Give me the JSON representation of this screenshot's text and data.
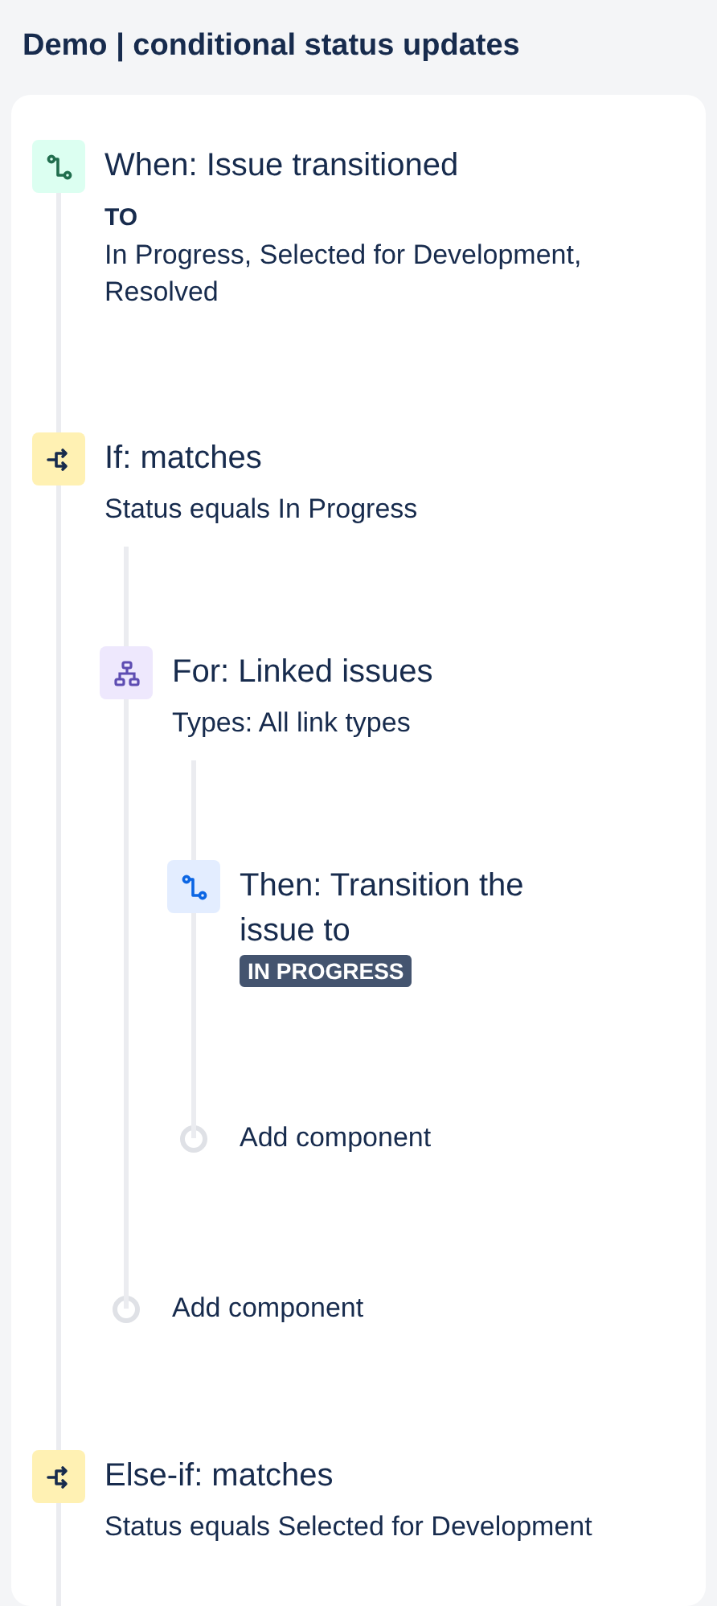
{
  "title": "Demo | conditional status updates",
  "steps": [
    {
      "kind": "trigger",
      "title": "When: Issue transitioned",
      "label": "TO",
      "detail": "In Progress, Selected for Development, Resolved"
    },
    {
      "kind": "condition",
      "title": "If: matches",
      "detail": "Status equals In Progress",
      "children": [
        {
          "kind": "branch",
          "title": "For: Linked issues",
          "detail": "Types: All link types",
          "children": [
            {
              "kind": "action",
              "title": "Then: Transition the issue to",
              "badge": "IN PROGRESS"
            },
            {
              "kind": "add",
              "title": "Add component"
            }
          ]
        },
        {
          "kind": "add",
          "title": "Add component"
        }
      ]
    },
    {
      "kind": "condition",
      "title": "Else-if: matches",
      "detail": "Status equals Selected for Development"
    }
  ]
}
